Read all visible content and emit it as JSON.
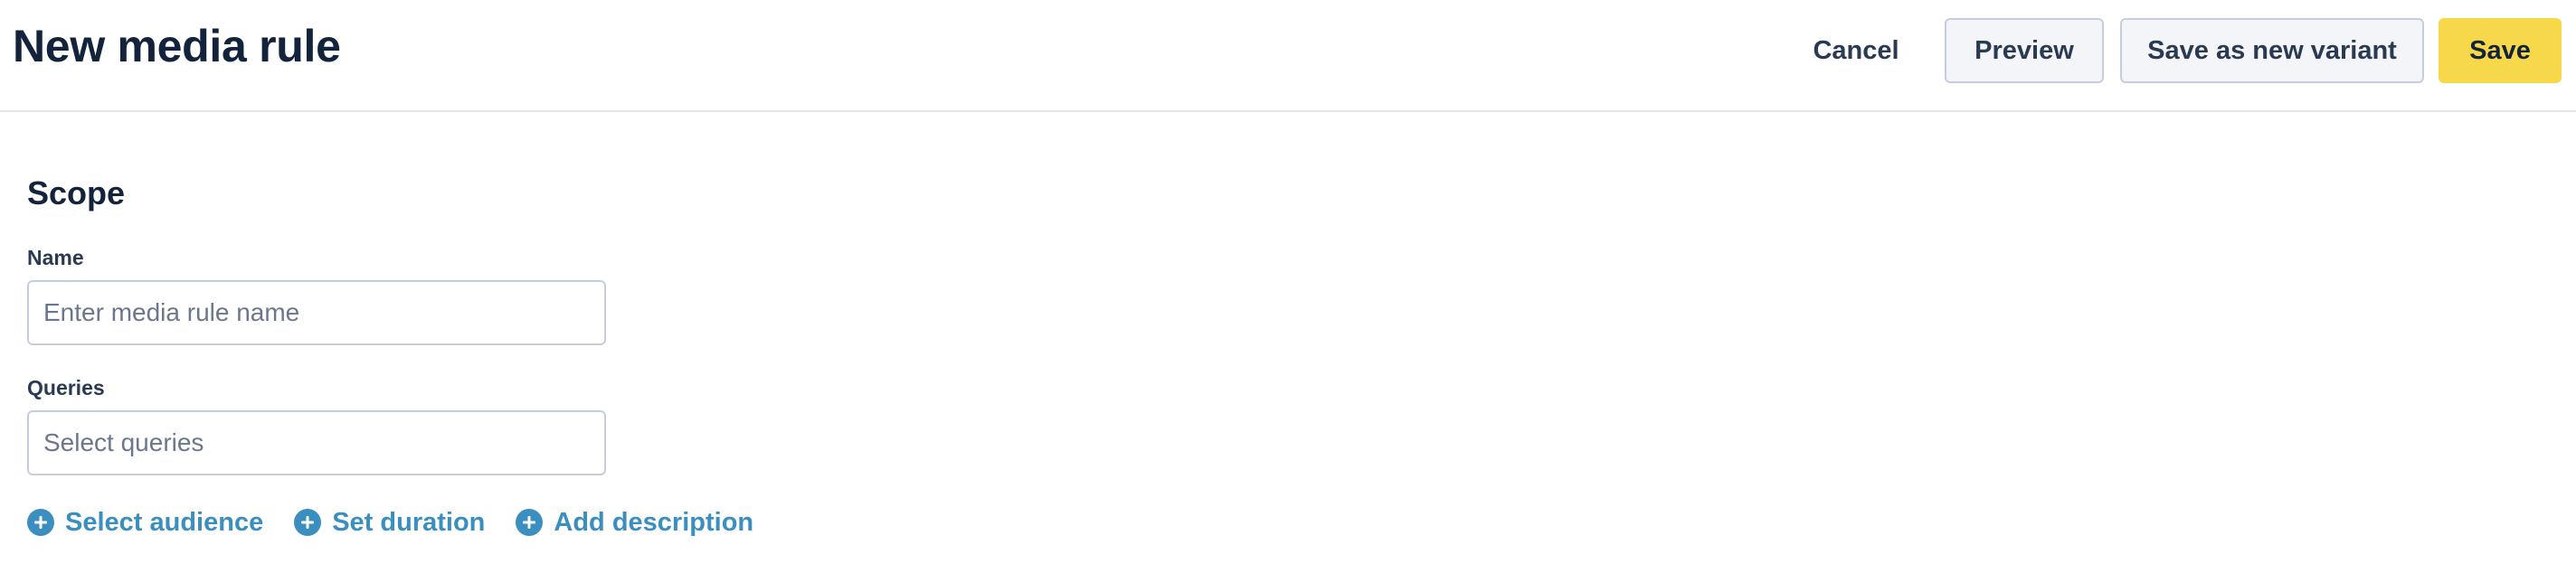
{
  "header": {
    "title": "New media rule",
    "cancel_label": "Cancel",
    "preview_label": "Preview",
    "save_variant_label": "Save as new variant",
    "save_label": "Save"
  },
  "scope": {
    "title": "Scope",
    "name_label": "Name",
    "name_placeholder": "Enter media rule name",
    "name_value": "",
    "queries_label": "Queries",
    "queries_placeholder": "Select queries"
  },
  "actions": {
    "select_audience": "Select audience",
    "set_duration": "Set duration",
    "add_description": "Add description"
  },
  "colors": {
    "primary_button": "#f7d84a",
    "link": "#3a8fc0",
    "title": "#12233b"
  },
  "icons": {
    "action_icon": "plus-circle-icon"
  }
}
